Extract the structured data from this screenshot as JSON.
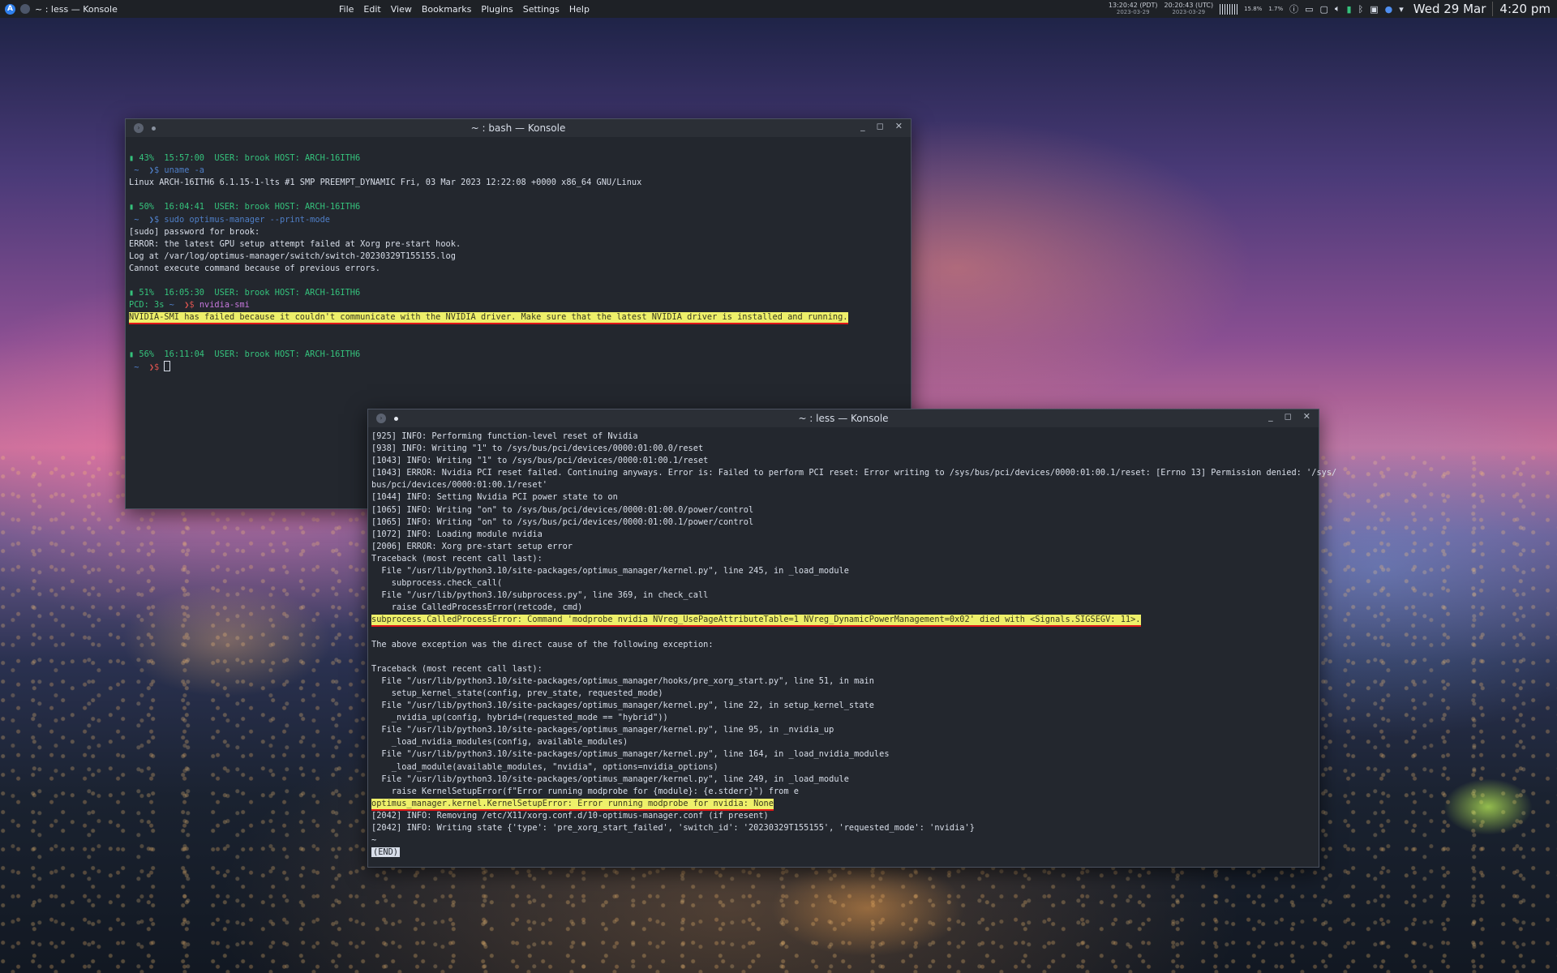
{
  "panel": {
    "launcher_label": "A",
    "task_title": "~ : less — Konsole",
    "menu": [
      "File",
      "Edit",
      "View",
      "Bookmarks",
      "Plugins",
      "Settings",
      "Help"
    ],
    "clocks": [
      {
        "time": "13:20:42 (PDT)",
        "date": "2023-03-29"
      },
      {
        "time": "20:20:43 (UTC)",
        "date": "2023-03-29"
      }
    ],
    "cpu": "15.8%",
    "mem": "1.7%",
    "date": "Wed 29 Mar",
    "time": "4:20 pm"
  },
  "bash": {
    "title": "~ : bash — Konsole",
    "lines": [
      {
        "parts": []
      },
      {
        "parts": [
          {
            "t": "▮ 43%  15:57:00  USER: brook HOST: ARCH-16ITH6",
            "c": "green"
          }
        ]
      },
      {
        "parts": [
          {
            "t": " ~  ❯$ ",
            "c": "blue"
          },
          {
            "t": "uname -a",
            "c": "blue"
          }
        ]
      },
      {
        "parts": [
          {
            "t": "Linux ARCH-16ITH6 6.1.15-1-lts #1 SMP PREEMPT_DYNAMIC Fri, 03 Mar 2023 12:22:08 +0000 x86_64 GNU/Linux",
            "c": ""
          }
        ]
      },
      {
        "parts": []
      },
      {
        "parts": [
          {
            "t": "▮ 50%  16:04:41  USER: brook HOST: ARCH-16ITH6",
            "c": "green"
          }
        ]
      },
      {
        "parts": [
          {
            "t": " ~  ❯$ ",
            "c": "blue"
          },
          {
            "t": "sudo optimus-manager --print-mode",
            "c": "blue"
          }
        ]
      },
      {
        "parts": [
          {
            "t": "[sudo] password for brook:",
            "c": ""
          }
        ]
      },
      {
        "parts": [
          {
            "t": "ERROR: the latest GPU setup attempt failed at Xorg pre-start hook.",
            "c": ""
          }
        ]
      },
      {
        "parts": [
          {
            "t": "Log at /var/log/optimus-manager/switch/switch-20230329T155155.log",
            "c": ""
          }
        ]
      },
      {
        "parts": [
          {
            "t": "Cannot execute command because of previous errors.",
            "c": ""
          }
        ]
      },
      {
        "parts": []
      },
      {
        "parts": [
          {
            "t": "▮ 51%  16:05:30  USER: brook HOST: ARCH-16ITH6",
            "c": "green"
          }
        ]
      },
      {
        "parts": [
          {
            "t": "PCD: 3s ",
            "c": "green"
          },
          {
            "t": "~  ",
            "c": "blue"
          },
          {
            "t": "❯$ ",
            "c": "red"
          },
          {
            "t": "nvidia-smi",
            "c": "purple"
          }
        ]
      },
      {
        "parts": [
          {
            "t": "NVIDIA-SMI has failed because it couldn't communicate with the NVIDIA driver. Make sure that the latest NVIDIA driver is installed and running.",
            "c": "hl"
          }
        ]
      },
      {
        "parts": []
      },
      {
        "parts": []
      },
      {
        "parts": [
          {
            "t": "▮ 56%  16:11:04  USER: brook HOST: ARCH-16ITH6",
            "c": "green"
          }
        ]
      },
      {
        "parts": [
          {
            "t": " ~  ",
            "c": "blue"
          },
          {
            "t": "❯$ ",
            "c": "red"
          }
        ]
      }
    ]
  },
  "less": {
    "title": "~ : less — Konsole",
    "lines": [
      {
        "parts": [
          {
            "t": "[925] INFO: Performing function-level reset of Nvidia",
            "c": ""
          }
        ]
      },
      {
        "parts": [
          {
            "t": "[938] INFO: Writing \"1\" to /sys/bus/pci/devices/0000:01:00.0/reset",
            "c": ""
          }
        ]
      },
      {
        "parts": [
          {
            "t": "[1043] INFO: Writing \"1\" to /sys/bus/pci/devices/0000:01:00.1/reset",
            "c": ""
          }
        ]
      },
      {
        "parts": [
          {
            "t": "[1043] ERROR: Nvidia PCI reset failed. Continuing anyways. Error is: Failed to perform PCI reset: Error writing to /sys/bus/pci/devices/0000:01:00.1/reset: [Errno 13] Permission denied: '/sys/",
            "c": ""
          }
        ]
      },
      {
        "parts": [
          {
            "t": "bus/pci/devices/0000:01:00.1/reset'",
            "c": ""
          }
        ]
      },
      {
        "parts": [
          {
            "t": "[1044] INFO: Setting Nvidia PCI power state to on",
            "c": ""
          }
        ]
      },
      {
        "parts": [
          {
            "t": "[1065] INFO: Writing \"on\" to /sys/bus/pci/devices/0000:01:00.0/power/control",
            "c": ""
          }
        ]
      },
      {
        "parts": [
          {
            "t": "[1065] INFO: Writing \"on\" to /sys/bus/pci/devices/0000:01:00.1/power/control",
            "c": ""
          }
        ]
      },
      {
        "parts": [
          {
            "t": "[1072] INFO: Loading module nvidia",
            "c": ""
          }
        ]
      },
      {
        "parts": [
          {
            "t": "[2006] ERROR: Xorg pre-start setup error",
            "c": ""
          }
        ]
      },
      {
        "parts": [
          {
            "t": "Traceback (most recent call last):",
            "c": ""
          }
        ]
      },
      {
        "parts": [
          {
            "t": "  File \"/usr/lib/python3.10/site-packages/optimus_manager/kernel.py\", line 245, in _load_module",
            "c": ""
          }
        ]
      },
      {
        "parts": [
          {
            "t": "    subprocess.check_call(",
            "c": ""
          }
        ]
      },
      {
        "parts": [
          {
            "t": "  File \"/usr/lib/python3.10/subprocess.py\", line 369, in check_call",
            "c": ""
          }
        ]
      },
      {
        "parts": [
          {
            "t": "    raise CalledProcessError(retcode, cmd)",
            "c": ""
          }
        ]
      },
      {
        "parts": [
          {
            "t": "subprocess.CalledProcessError: Command 'modprobe nvidia NVreg_UsePageAttributeTable=1 NVreg_DynamicPowerManagement=0x02' died with <Signals.SIGSEGV: 11>.",
            "c": "hl"
          }
        ]
      },
      {
        "parts": []
      },
      {
        "parts": [
          {
            "t": "The above exception was the direct cause of the following exception:",
            "c": ""
          }
        ]
      },
      {
        "parts": []
      },
      {
        "parts": [
          {
            "t": "Traceback (most recent call last):",
            "c": ""
          }
        ]
      },
      {
        "parts": [
          {
            "t": "  File \"/usr/lib/python3.10/site-packages/optimus_manager/hooks/pre_xorg_start.py\", line 51, in main",
            "c": ""
          }
        ]
      },
      {
        "parts": [
          {
            "t": "    setup_kernel_state(config, prev_state, requested_mode)",
            "c": ""
          }
        ]
      },
      {
        "parts": [
          {
            "t": "  File \"/usr/lib/python3.10/site-packages/optimus_manager/kernel.py\", line 22, in setup_kernel_state",
            "c": ""
          }
        ]
      },
      {
        "parts": [
          {
            "t": "    _nvidia_up(config, hybrid=(requested_mode == \"hybrid\"))",
            "c": ""
          }
        ]
      },
      {
        "parts": [
          {
            "t": "  File \"/usr/lib/python3.10/site-packages/optimus_manager/kernel.py\", line 95, in _nvidia_up",
            "c": ""
          }
        ]
      },
      {
        "parts": [
          {
            "t": "    _load_nvidia_modules(config, available_modules)",
            "c": ""
          }
        ]
      },
      {
        "parts": [
          {
            "t": "  File \"/usr/lib/python3.10/site-packages/optimus_manager/kernel.py\", line 164, in _load_nvidia_modules",
            "c": ""
          }
        ]
      },
      {
        "parts": [
          {
            "t": "    _load_module(available_modules, \"nvidia\", options=nvidia_options)",
            "c": ""
          }
        ]
      },
      {
        "parts": [
          {
            "t": "  File \"/usr/lib/python3.10/site-packages/optimus_manager/kernel.py\", line 249, in _load_module",
            "c": ""
          }
        ]
      },
      {
        "parts": [
          {
            "t": "    raise KernelSetupError(f\"Error running modprobe for {module}: {e.stderr}\") from e",
            "c": ""
          }
        ]
      },
      {
        "parts": [
          {
            "t": "optimus_manager.kernel.KernelSetupError: Error running modprobe for nvidia: None",
            "c": "hl"
          }
        ]
      },
      {
        "parts": [
          {
            "t": "[2042] INFO: Removing /etc/X11/xorg.conf.d/10-optimus-manager.conf (if present)",
            "c": ""
          }
        ]
      },
      {
        "parts": [
          {
            "t": "[2042] INFO: Writing state {'type': 'pre_xorg_start_failed', 'switch_id': '20230329T155155', 'requested_mode': 'nvidia'}",
            "c": ""
          }
        ]
      },
      {
        "parts": [
          {
            "t": "~",
            "c": ""
          }
        ]
      }
    ],
    "end_label": "(END)"
  }
}
